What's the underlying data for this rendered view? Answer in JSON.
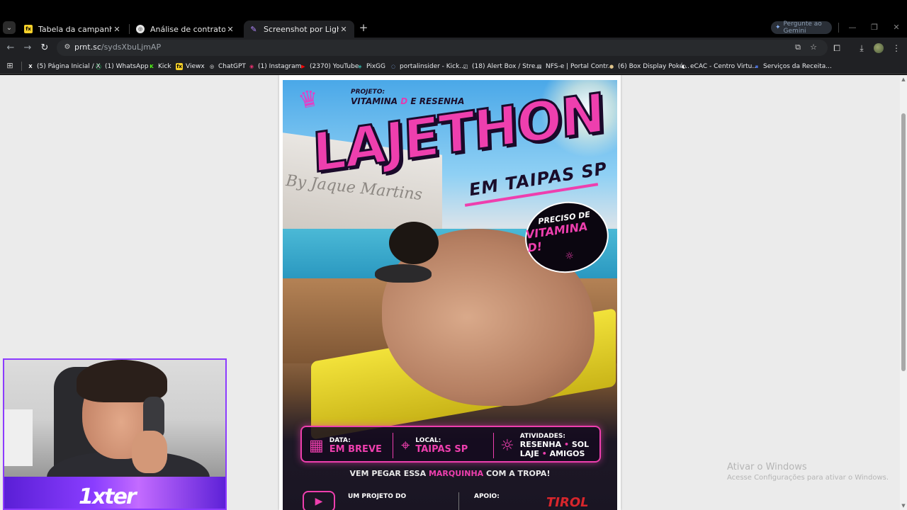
{
  "tabs": [
    {
      "title": "Tabela da campanha | Viewx",
      "favicon": "viewx-icon"
    },
    {
      "title": "Análise de contrato contábil",
      "favicon": "chatgpt-icon"
    },
    {
      "title": "Screenshot por Lightshot",
      "favicon": "lightshot-icon",
      "active": true
    }
  ],
  "gemini_button": "Pergunte ao Gemini",
  "omnibox": {
    "host": "prnt.sc",
    "path": "/sydsXbuLjmAP"
  },
  "bookmarks": [
    "(5) Página Inicial / X",
    "(1) WhatsApp",
    "Kick",
    "Viewx",
    "ChatGPT",
    "(1) Instagram",
    "(2370) YouTube",
    "PixGG",
    "portalinsider - Kick...",
    "(18) Alert Box / Stre...",
    "NFS-e | Portal Contr...",
    "(6) Box Display Poké...",
    "eCAC - Centro Virtu...",
    "Serviços da Receita..."
  ],
  "poster": {
    "pre_label": "PROJETO:",
    "pre_title_1": "VITAMINA ",
    "pre_title_d": "D",
    "pre_title_2": " E RESENHA",
    "headline": "LAJETHON",
    "subheadline": "EM TAIPAS SP",
    "wall_signature": "By Jaque Martins",
    "bubble_line1": "PRECISO DE",
    "bubble_line2": "VITAMINA D!",
    "data_label": "DATA:",
    "data_value": "EM BREVE",
    "local_label": "LOCAL:",
    "local_value": "TAIPAS SP",
    "atividades_label": "ATIVIDADES:",
    "atividades_line1_a": "RESENHA",
    "atividades_line1_b": "SOL",
    "atividades_line2_a": "LAJE",
    "atividades_line2_b": "AMIGOS",
    "cta_before": "VEM PEGAR ESSA ",
    "cta_highlight": "MARQUINHA",
    "cta_after": " COM A TROPA!",
    "footer_left": "UM PROJETO DO",
    "footer_right": "APOIO:",
    "sponsor": "TIROL"
  },
  "webcam_logo": "1xter",
  "watermark": {
    "title": "Ativar o Windows",
    "subtitle": "Acesse Configurações para ativar o Windows."
  },
  "colors": {
    "accent_pink": "#ee3fae",
    "webcam_border": "#8c3bff",
    "page_bg": "#ebebeb",
    "chrome_dark": "#202124"
  }
}
